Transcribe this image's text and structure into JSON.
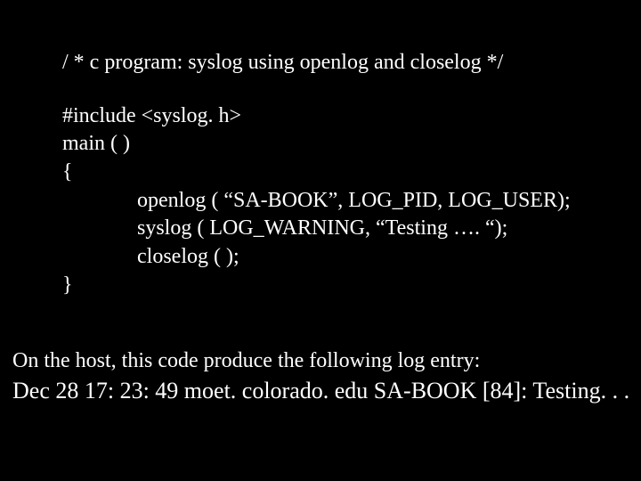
{
  "code": {
    "title": "/ * c program: syslog using openlog and closelog */",
    "include": "#include <syslog. h>",
    "main": "main (  )",
    "brace_open": "{",
    "stmt1": "openlog ( “SA-BOOK”, LOG_PID, LOG_USER);",
    "stmt2": "syslog ( LOG_WARNING, “Testing …. “);",
    "stmt3": "closelog (  );",
    "brace_close": "}"
  },
  "footer": {
    "line1": "On the host, this code produce the following log entry:",
    "line2": "Dec 28 17: 23: 49  moet. colorado. edu  SA-BOOK [84]: Testing. . ."
  }
}
